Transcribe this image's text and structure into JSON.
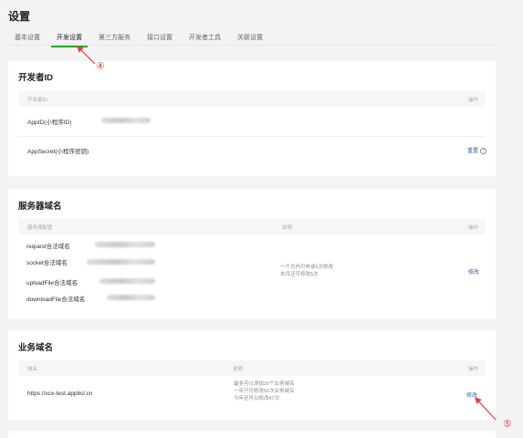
{
  "page": {
    "title": "设置"
  },
  "tabs": [
    {
      "label": "基本设置"
    },
    {
      "label": "开发设置"
    },
    {
      "label": "第三方服务"
    },
    {
      "label": "接口设置"
    },
    {
      "label": "开发者工具"
    },
    {
      "label": "关联设置"
    }
  ],
  "developer_id": {
    "title": "开发者ID",
    "header_left": "开发者ID",
    "header_right": "操作",
    "rows": [
      {
        "label": "AppID(小程序ID)"
      },
      {
        "label": "AppSecret(小程序密钥)",
        "action": "重置"
      }
    ]
  },
  "server_domain": {
    "title": "服务器域名",
    "header_left": "服务器配置",
    "header_mid": "说明",
    "header_right": "操作",
    "rows": [
      {
        "label": "request合法域名"
      },
      {
        "label": "socket合法域名"
      },
      {
        "label": "uploadFile合法域名"
      },
      {
        "label": "downloadFile合法域名"
      }
    ],
    "note_line1": "一个月内可申请5次修改",
    "note_line2": "本月还可修改5次",
    "action": "修改"
  },
  "business_domain": {
    "title": "业务域名",
    "header_left": "域名",
    "header_mid": "说明",
    "header_right": "操作",
    "domain": "https://xcx-test.appbsl.cn",
    "note_line1": "最多可以添加20个业务域名",
    "note_line2": "一年只可修改50次业务域名",
    "note_line3": "今年还可以修改47次",
    "action": "修改"
  },
  "annotations": {
    "marker4": "④",
    "marker5": "⑤",
    "color": "#e04040"
  },
  "colors": {
    "accent": "#1aad19",
    "link": "#2e63a8"
  }
}
